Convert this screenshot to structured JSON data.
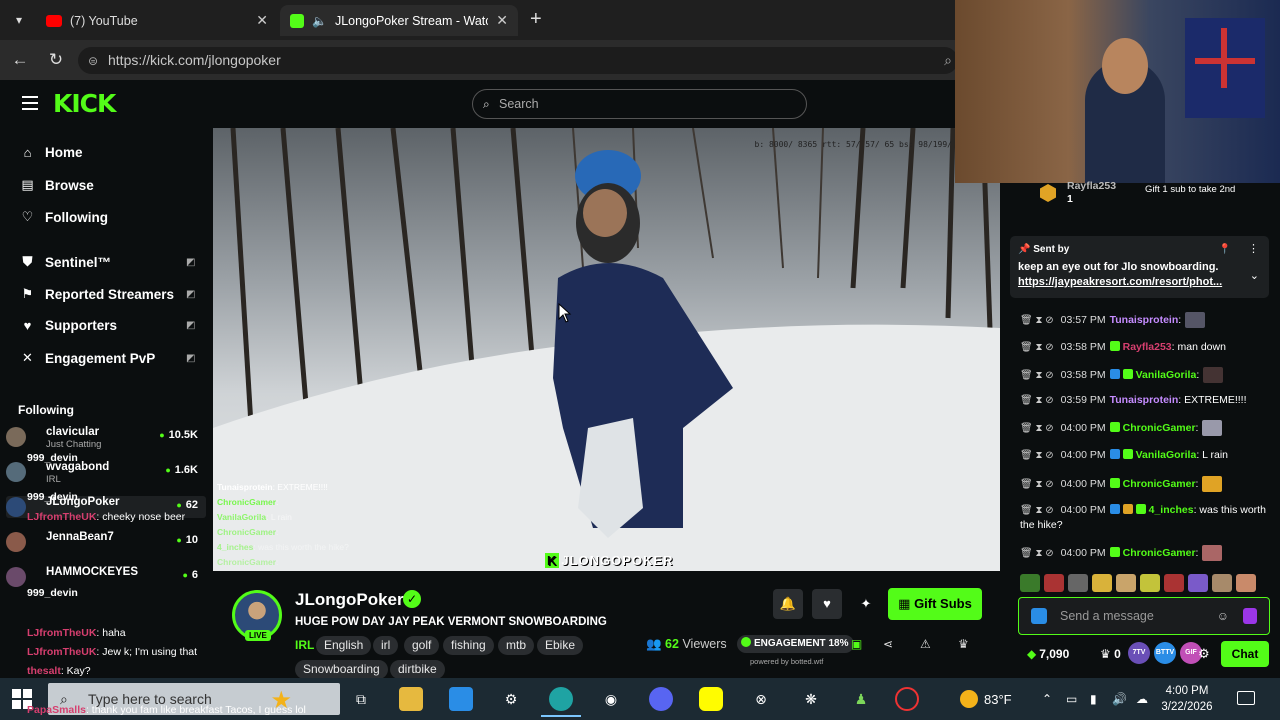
{
  "browser": {
    "tabs": [
      {
        "title": "(7) YouTube",
        "active": false,
        "icon": "youtube-icon",
        "color": "#ff0000"
      },
      {
        "title": "JLongoPoker Stream - Watch",
        "active": true,
        "icon": "kick-icon",
        "color": "#53fc18"
      }
    ],
    "url": "https://kick.com/jlongopoker"
  },
  "kick": {
    "logo": "KICK",
    "search_placeholder": "Search",
    "nav": [
      {
        "label": "Home",
        "icon": "home-icon"
      },
      {
        "label": "Browse",
        "icon": "browse-icon"
      },
      {
        "label": "Following",
        "icon": "heart-icon"
      }
    ],
    "nav2": [
      {
        "label": "Sentinel™",
        "icon": "shield-icon"
      },
      {
        "label": "Reported Streamers",
        "icon": "flag-icon"
      },
      {
        "label": "Supporters",
        "icon": "heart-icon"
      },
      {
        "label": "Engagement PvP",
        "icon": "pvp-icon"
      }
    ],
    "following_heading": "Following",
    "following": [
      {
        "name": "clavicular",
        "category": "Just Chatting",
        "viewers": "10.5K"
      },
      {
        "name": "wvagabond",
        "category": "IRL",
        "viewers": "1.6K"
      },
      {
        "name": "JLongoPoker",
        "category": "",
        "viewers": "62"
      },
      {
        "name": "JennaBean7",
        "category": "",
        "viewers": "10"
      },
      {
        "name": "HAMMOCKEYES",
        "category": "",
        "viewers": "6"
      }
    ],
    "sidebar_overlay_chat": [
      {
        "user": "999_devin",
        "text": ""
      },
      {
        "user": "999_devin",
        "text": ""
      },
      {
        "user": "LJfromTheUK",
        "text": ": cheeky nose beer"
      },
      {
        "user": "999_devin",
        "text": ""
      },
      {
        "user": "LJfromTheUK",
        "text": ": haha"
      },
      {
        "user": "LJfromTheUK",
        "text": ": Jew k; I'm using that"
      },
      {
        "user": "thesalt",
        "text": ": Kay?"
      },
      {
        "user": "PapaSmalls",
        "text": ": thank you fam like breakfast Tacos, I guess lol"
      }
    ]
  },
  "video": {
    "stats": "b: 8000/ 8365 rtt: 57/ 57/ 65 bs: 98/199/",
    "watermark": "JLONGOPOKER",
    "overlay_chat": [
      {
        "user": "Tunaisprotein",
        "text": ": EXTREME!!!!",
        "color": "#c58cff"
      },
      {
        "user": "ChronicGamer",
        "text": ":",
        "color": "#53fc18"
      },
      {
        "user": "VanilaGorila",
        "text": ": L rain",
        "color": "#53fc18"
      },
      {
        "user": "ChronicGamer",
        "text": ":",
        "color": "#53fc18"
      },
      {
        "user": "4_inches",
        "text": ": was this worth the hike?",
        "color": "#53fc18"
      },
      {
        "user": "ChronicGamer",
        "text": ":",
        "color": "#53fc18"
      }
    ]
  },
  "channel": {
    "name": "JLongoPoker",
    "live_label": "LIVE",
    "title": "HUGE POW DAY JAY PEAK VERMONT SNOWBOARDING",
    "category": "IRL",
    "tags": [
      "English",
      "irl",
      "golf",
      "fishing",
      "mtb",
      "Ebike",
      "Snowboarding",
      "dirtbike"
    ],
    "viewers": "62",
    "viewers_label": "Viewers",
    "engagement_label": "ENGAGEMENT",
    "engagement_value": "18%",
    "powered_by": "powered by botted.wtf",
    "gift_label": "Gift Subs"
  },
  "chat": {
    "gifter": {
      "name": "Rayfla253",
      "count": "1",
      "text": "Gift 1 sub to take 2nd"
    },
    "pinned": {
      "sent_by": "Sent by",
      "message": "keep an eye out for Jlo snowboarding.",
      "link": "https://jaypeakresort.com/resort/phot..."
    },
    "messages": [
      {
        "time": "03:57 PM",
        "user": "Tunaisprotein",
        "text": ":",
        "color": "#c58cff",
        "emote": true
      },
      {
        "time": "03:58 PM",
        "user": "Rayfla253",
        "text": ": man down",
        "color": "#d63f6f",
        "emote": false
      },
      {
        "time": "03:58 PM",
        "user": "VanilaGorila",
        "text": ":",
        "color": "#53fc18",
        "emote": true
      },
      {
        "time": "03:59 PM",
        "user": "Tunaisprotein",
        "text": ": EXTREME!!!!",
        "color": "#c58cff",
        "emote": false
      },
      {
        "time": "04:00 PM",
        "user": "ChronicGamer",
        "text": ":",
        "color": "#53fc18",
        "emote": true
      },
      {
        "time": "04:00 PM",
        "user": "VanilaGorila",
        "text": ": L rain",
        "color": "#53fc18",
        "emote": false
      },
      {
        "time": "04:00 PM",
        "user": "ChronicGamer",
        "text": ":",
        "color": "#53fc18",
        "emote": true
      },
      {
        "time": "04:00 PM",
        "user": "4_inches",
        "text": ": was this worth the hike?",
        "color": "#53fc18",
        "emote": false
      },
      {
        "time": "04:00 PM",
        "user": "ChronicGamer",
        "text": ":",
        "color": "#53fc18",
        "emote": true
      }
    ],
    "input_placeholder": "Send a message",
    "points": "7,090",
    "zero": "0",
    "chat_button": "Chat",
    "badges": [
      "7TV",
      "BTTV",
      "GIF"
    ]
  },
  "taskbar": {
    "search_placeholder": "Type here to search",
    "temperature": "83°F",
    "time": "4:00 PM",
    "date": "3/22/2026"
  }
}
